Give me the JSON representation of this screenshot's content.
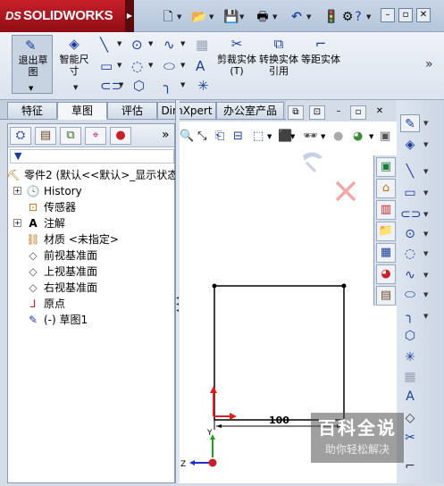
{
  "app": {
    "logo": "SOLIDWORKS",
    "logo_mark": "DS"
  },
  "ribbon": {
    "exit_sketch": "退出草图",
    "smart_dimension": "智能尺寸",
    "trim_entities": "剪裁实体(T)",
    "convert_entities": "转换实体引用",
    "offset_entities": "等距实体"
  },
  "tabs": [
    "特征",
    "草图",
    "评估",
    "DimXpert",
    "办公室产品"
  ],
  "tree": {
    "part": "零件2 (默认<<默认>_显示状态",
    "items": [
      "History",
      "传感器",
      "注解",
      "材质 <未指定>",
      "前视基准面",
      "上视基准面",
      "右视基准面",
      "原点",
      "(-) 草图1"
    ]
  },
  "sketch": {
    "dimension": "100",
    "axis_x": "X",
    "axis_y": "Y",
    "axis_z": "Z"
  },
  "watermark": {
    "title": "百科全说",
    "subtitle": "助你轻松解决"
  },
  "colors": {
    "logo": "#c8202a",
    "graphics_bg": "#ffffff"
  }
}
